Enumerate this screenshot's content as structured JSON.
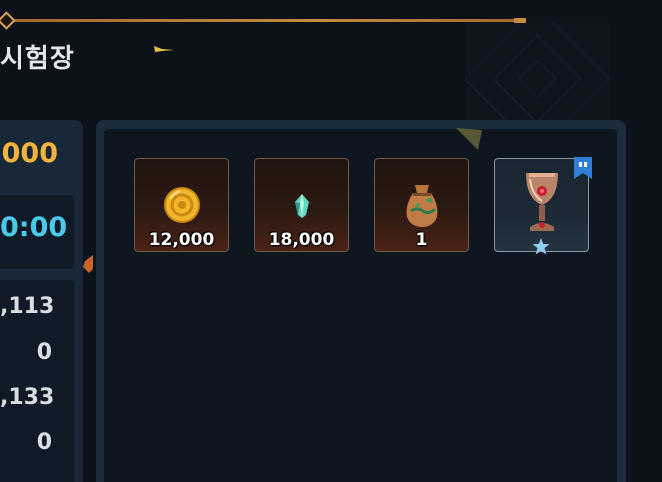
{
  "header": {
    "title": "시험장"
  },
  "left_panel": {
    "gold_value": "000",
    "timer_value": "0:00",
    "stats": [
      ",113",
      "0",
      ",133",
      "0"
    ]
  },
  "rewards": [
    {
      "icon": "gold-coin-icon",
      "count": "12,000"
    },
    {
      "icon": "crystal-gem-icon",
      "count": "18,000"
    },
    {
      "icon": "seed-pouch-icon",
      "count": "1"
    },
    {
      "icon": "ruby-goblet-icon",
      "count": "",
      "badges": [
        "bookmark-icon",
        "star-icon"
      ]
    }
  ],
  "colors": {
    "gold_text": "#f2b43a",
    "timer_text": "#49c9ea",
    "accent_line": "#c58a3e",
    "panel_bg": "#1b2c3c"
  }
}
